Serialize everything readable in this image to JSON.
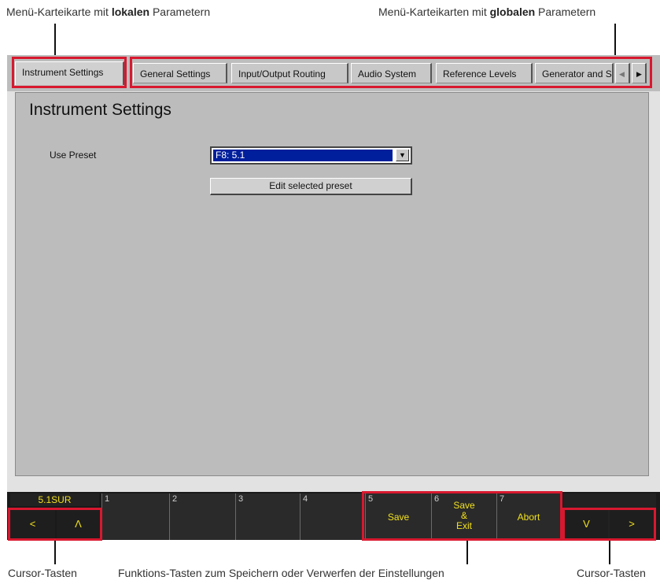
{
  "annotations": {
    "local_tab_pre": "Menü-Karteikarte mit ",
    "local_tab_bold": "lokalen",
    "local_tab_post": " Parametern",
    "global_tabs_pre": "Menü-Karteikarten mit ",
    "global_tabs_bold": "globalen",
    "global_tabs_post": " Parametern",
    "cursor_left": "Cursor-Tasten",
    "function_keys": "Funktions-Tasten zum Speichern oder Verwerfen der Einstellungen",
    "cursor_right": "Cursor-Tasten"
  },
  "tabs": {
    "local": "Instrument Settings",
    "global": [
      "General Settings",
      "Input/Output Routing",
      "Audio System",
      "Reference Levels",
      "Generator and S"
    ],
    "scroll_left": "◀",
    "scroll_right": "▶"
  },
  "page": {
    "title": "Instrument Settings",
    "use_preset_label": "Use Preset",
    "preset_value": "F8: 5.1",
    "dropdown_arrow": "▼",
    "edit_button": "Edit selected preset"
  },
  "function_bar": {
    "status": "5.1SUR",
    "keys": [
      {
        "num": "1",
        "label": ""
      },
      {
        "num": "2",
        "label": ""
      },
      {
        "num": "3",
        "label": ""
      },
      {
        "num": "4",
        "label": ""
      },
      {
        "num": "5",
        "label": "Save"
      },
      {
        "num": "6",
        "label": "Save\n&\nExit"
      },
      {
        "num": "7",
        "label": "Abort"
      }
    ],
    "cursor_left_keys": [
      "<",
      "Λ"
    ],
    "cursor_right_keys": [
      "V",
      ">"
    ]
  },
  "colors": {
    "highlight": "#d8182f",
    "softkey_text": "#f2e11c",
    "selection": "#001f9c"
  }
}
